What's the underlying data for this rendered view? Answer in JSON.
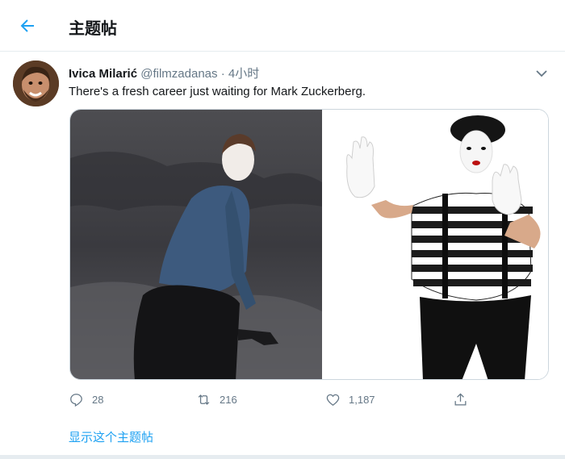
{
  "header": {
    "title": "主题帖",
    "back_icon": "arrow-left-icon",
    "accent": "#1da1f2"
  },
  "tweet": {
    "author_name": "Ivica Milarić",
    "handle": "@filmzadanas",
    "separator": "·",
    "time": "4小时",
    "text": "There's a fresh career just waiting for Mark Zuckerberg.",
    "menu_icon": "chevron-down-icon",
    "media": {
      "left_image_icon": "photo-person-in-blue-shirt",
      "right_image_icon": "photo-mime-costume"
    },
    "actions": {
      "reply": {
        "icon": "reply-icon",
        "count": "28"
      },
      "retweet": {
        "icon": "retweet-icon",
        "count": "216"
      },
      "like": {
        "icon": "heart-icon",
        "count": "1,187"
      },
      "share": {
        "icon": "share-icon"
      }
    },
    "show_thread": "显示这个主题帖"
  }
}
